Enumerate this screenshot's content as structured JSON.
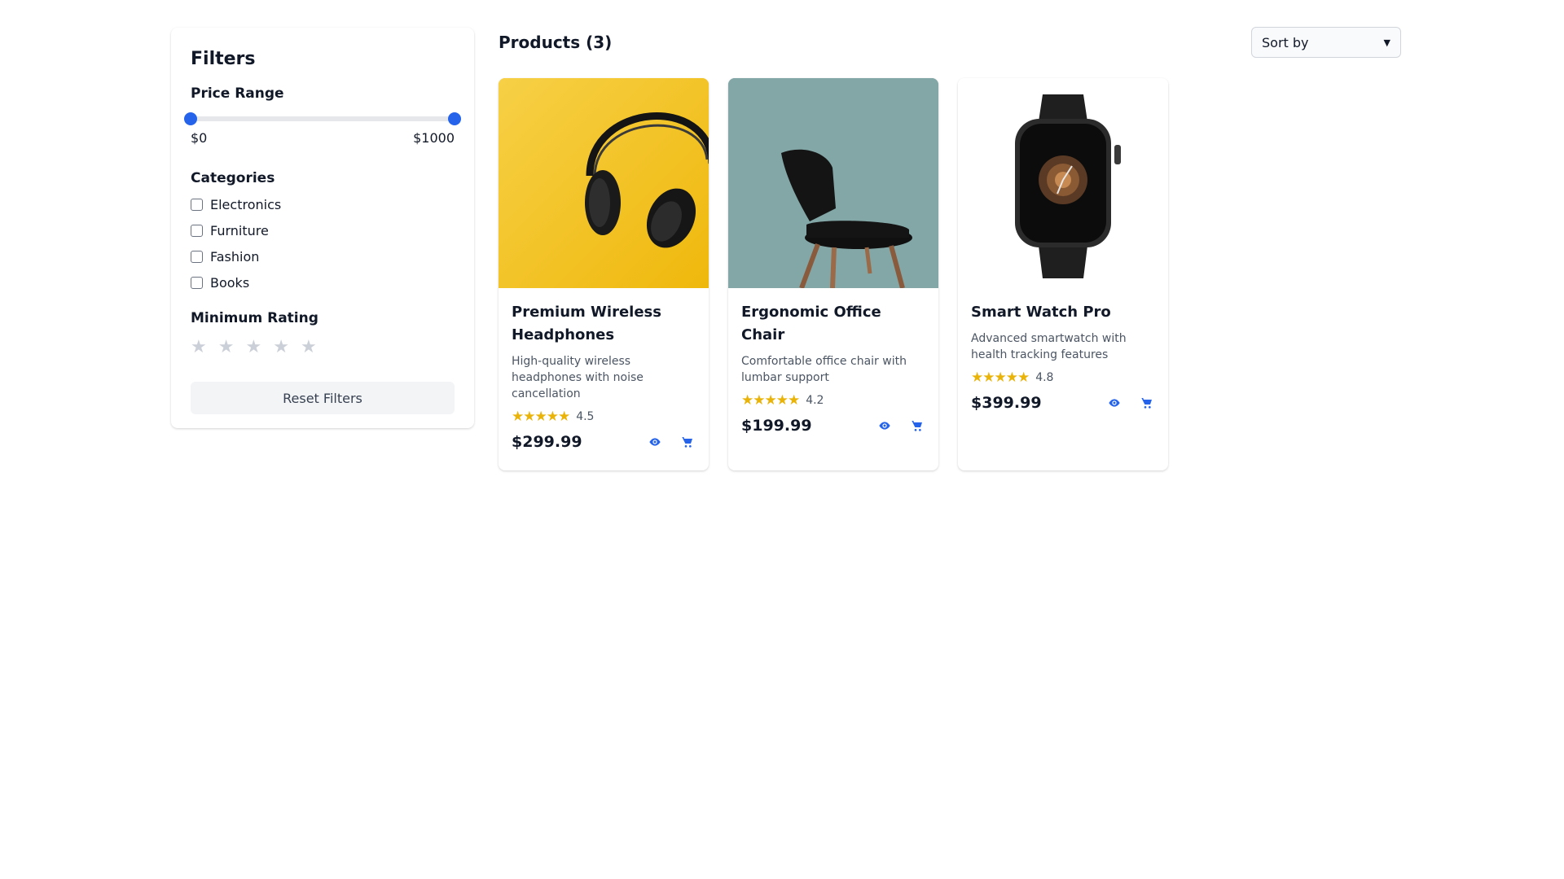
{
  "filters": {
    "title": "Filters",
    "price_range": {
      "title": "Price Range",
      "min_label": "$0",
      "max_label": "$1000",
      "min": 0,
      "max": 1000
    },
    "categories": {
      "title": "Categories",
      "items": [
        {
          "label": "Electronics",
          "checked": false
        },
        {
          "label": "Furniture",
          "checked": false
        },
        {
          "label": "Fashion",
          "checked": false
        },
        {
          "label": "Books",
          "checked": false
        }
      ]
    },
    "rating": {
      "title": "Minimum Rating",
      "value": 0,
      "max": 5
    },
    "reset_label": "Reset Filters"
  },
  "header": {
    "title": "Products (3)",
    "sort": {
      "selected": "Sort by"
    }
  },
  "products": [
    {
      "name": "Premium Wireless Headphones",
      "description": "High-quality wireless headphones with noise cancellation",
      "rating": "4.5",
      "price": "$299.99"
    },
    {
      "name": "Ergonomic Office Chair",
      "description": "Comfortable office chair with lumbar support",
      "rating": "4.2",
      "price": "$199.99"
    },
    {
      "name": "Smart Watch Pro",
      "description": "Advanced smartwatch with health tracking features",
      "rating": "4.8",
      "price": "$399.99"
    }
  ],
  "icons": {
    "view": "eye-icon",
    "cart": "cart-icon",
    "rating": "star-icon",
    "sort": "chevron-down-icon"
  },
  "colors": {
    "accent": "#2563eb",
    "star": "#eab308",
    "star_empty": "#cbd0d8"
  }
}
